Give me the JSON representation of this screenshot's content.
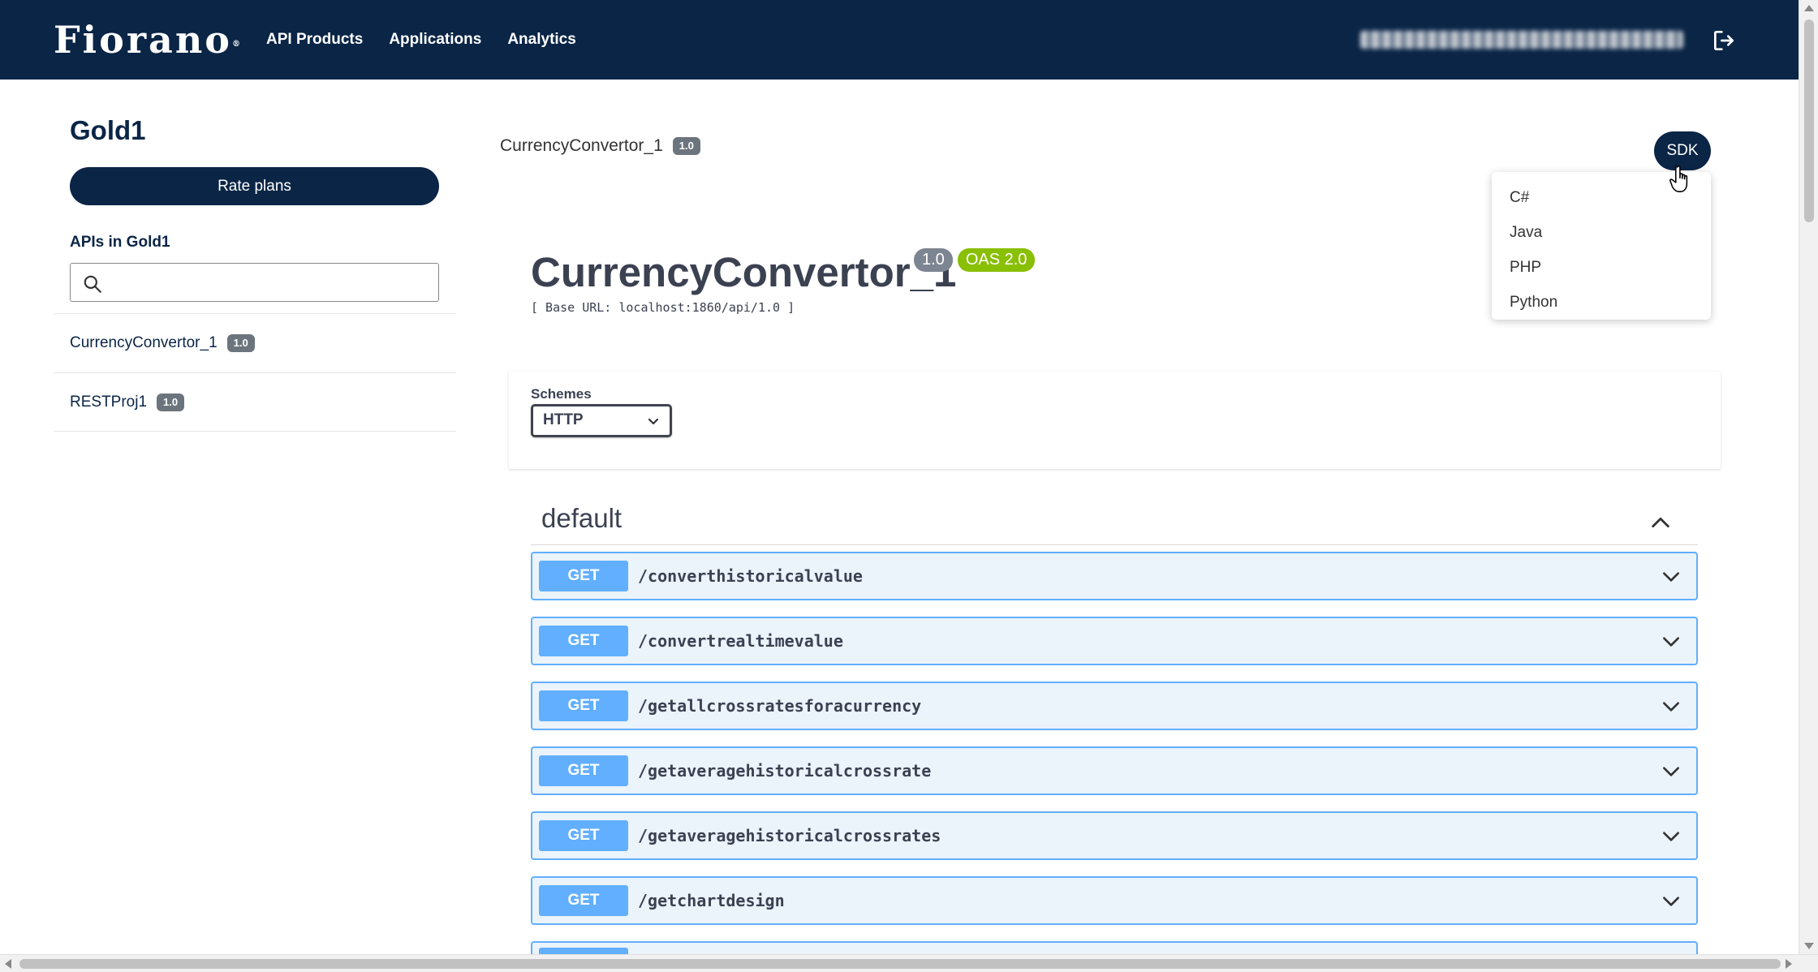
{
  "header": {
    "logo_text": "Fiorano",
    "logo_mark": "®",
    "nav": [
      "API Products",
      "Applications",
      "Analytics"
    ]
  },
  "sidebar": {
    "product_title": "Gold1",
    "rate_plans_label": "Rate plans",
    "apis_label": "APIs in Gold1",
    "search_placeholder": "",
    "apis": [
      {
        "name": "CurrencyConvertor_1",
        "version": "1.0"
      },
      {
        "name": "RESTProj1",
        "version": "1.0"
      }
    ]
  },
  "main": {
    "breadcrumb": {
      "name": "CurrencyConvertor_1",
      "version": "1.0"
    },
    "sdk_label": "SDK",
    "sdk_options": [
      "C#",
      "Java",
      "PHP",
      "Python"
    ],
    "api_title": "CurrencyConvertor_1",
    "version_badge": "1.0",
    "oas_badge": "OAS 2.0",
    "base_url": "[ Base URL: localhost:1860/api/1.0 ]",
    "schemes_label": "Schemes",
    "scheme_value": "HTTP",
    "tag": "default",
    "operations": [
      {
        "method": "GET",
        "path": "/converthistoricalvalue"
      },
      {
        "method": "GET",
        "path": "/convertrealtimevalue"
      },
      {
        "method": "GET",
        "path": "/getallcrossratesforacurrency"
      },
      {
        "method": "GET",
        "path": "/getaveragehistoricalcrossrate"
      },
      {
        "method": "GET",
        "path": "/getaveragehistoricalcrossrates"
      },
      {
        "method": "GET",
        "path": "/getchartdesign"
      }
    ]
  },
  "colors": {
    "navy": "#0b2546",
    "get_blue": "#61affe",
    "get_bg": "#ebf3fb",
    "oas_green": "#89bf04",
    "badge_gray": "#6c757d"
  }
}
